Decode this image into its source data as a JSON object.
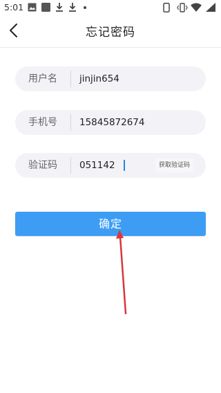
{
  "status_bar": {
    "time": "5:01",
    "left_icons": [
      "image-icon",
      "app-square-icon",
      "download-icon",
      "download-icon",
      "notification-dot-icon"
    ],
    "right_icons": [
      "portrait-lock-icon",
      "vibrate-icon",
      "wifi-icon",
      "signal-icon"
    ]
  },
  "app_bar": {
    "back_icon": "chevron-left-icon",
    "title": "忘记密码"
  },
  "form": {
    "username": {
      "label": "用户名",
      "value": "jinjin654"
    },
    "phone": {
      "label": "手机号",
      "value": "15845872674"
    },
    "code": {
      "label": "验证码",
      "value": "051142",
      "get_code_label": "获取验证码"
    }
  },
  "confirm_label": "确定",
  "colors": {
    "accent": "#3d9df5",
    "field_bg": "#f3f3f7",
    "annotation": "#d9363e"
  }
}
